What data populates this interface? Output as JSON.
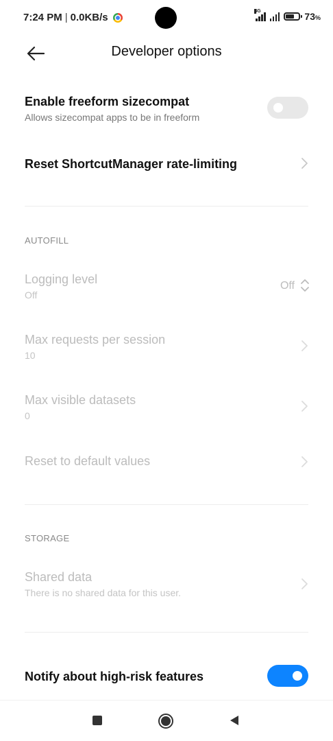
{
  "status_bar": {
    "time": "7:24 PM",
    "separator": "|",
    "speed": "0.0KB/s",
    "network": "4G",
    "battery_pct": "73",
    "battery_unit": "%"
  },
  "header": {
    "title": "Developer options"
  },
  "freeform": {
    "title": "Enable freeform sizecompat",
    "subtitle": "Allows sizecompat apps to be in freeform",
    "enabled": false
  },
  "shortcut_reset": {
    "title": "Reset ShortcutManager rate-limiting"
  },
  "autofill": {
    "header": "AUTOFILL",
    "logging_level": {
      "title": "Logging level",
      "subtitle": "Off",
      "value": "Off"
    },
    "max_requests": {
      "title": "Max requests per session",
      "subtitle": "10"
    },
    "max_visible": {
      "title": "Max visible datasets",
      "subtitle": "0"
    },
    "reset_defaults": {
      "title": "Reset to default values"
    }
  },
  "storage": {
    "header": "STORAGE",
    "shared_data": {
      "title": "Shared data",
      "subtitle": "There is no shared data for this user."
    }
  },
  "notify": {
    "title": "Notify about high-risk features",
    "enabled": true
  },
  "colors": {
    "accent": "#0d84ff",
    "toggle_off": "#e8e8e8",
    "disabled_text": "#bcbcbc"
  }
}
